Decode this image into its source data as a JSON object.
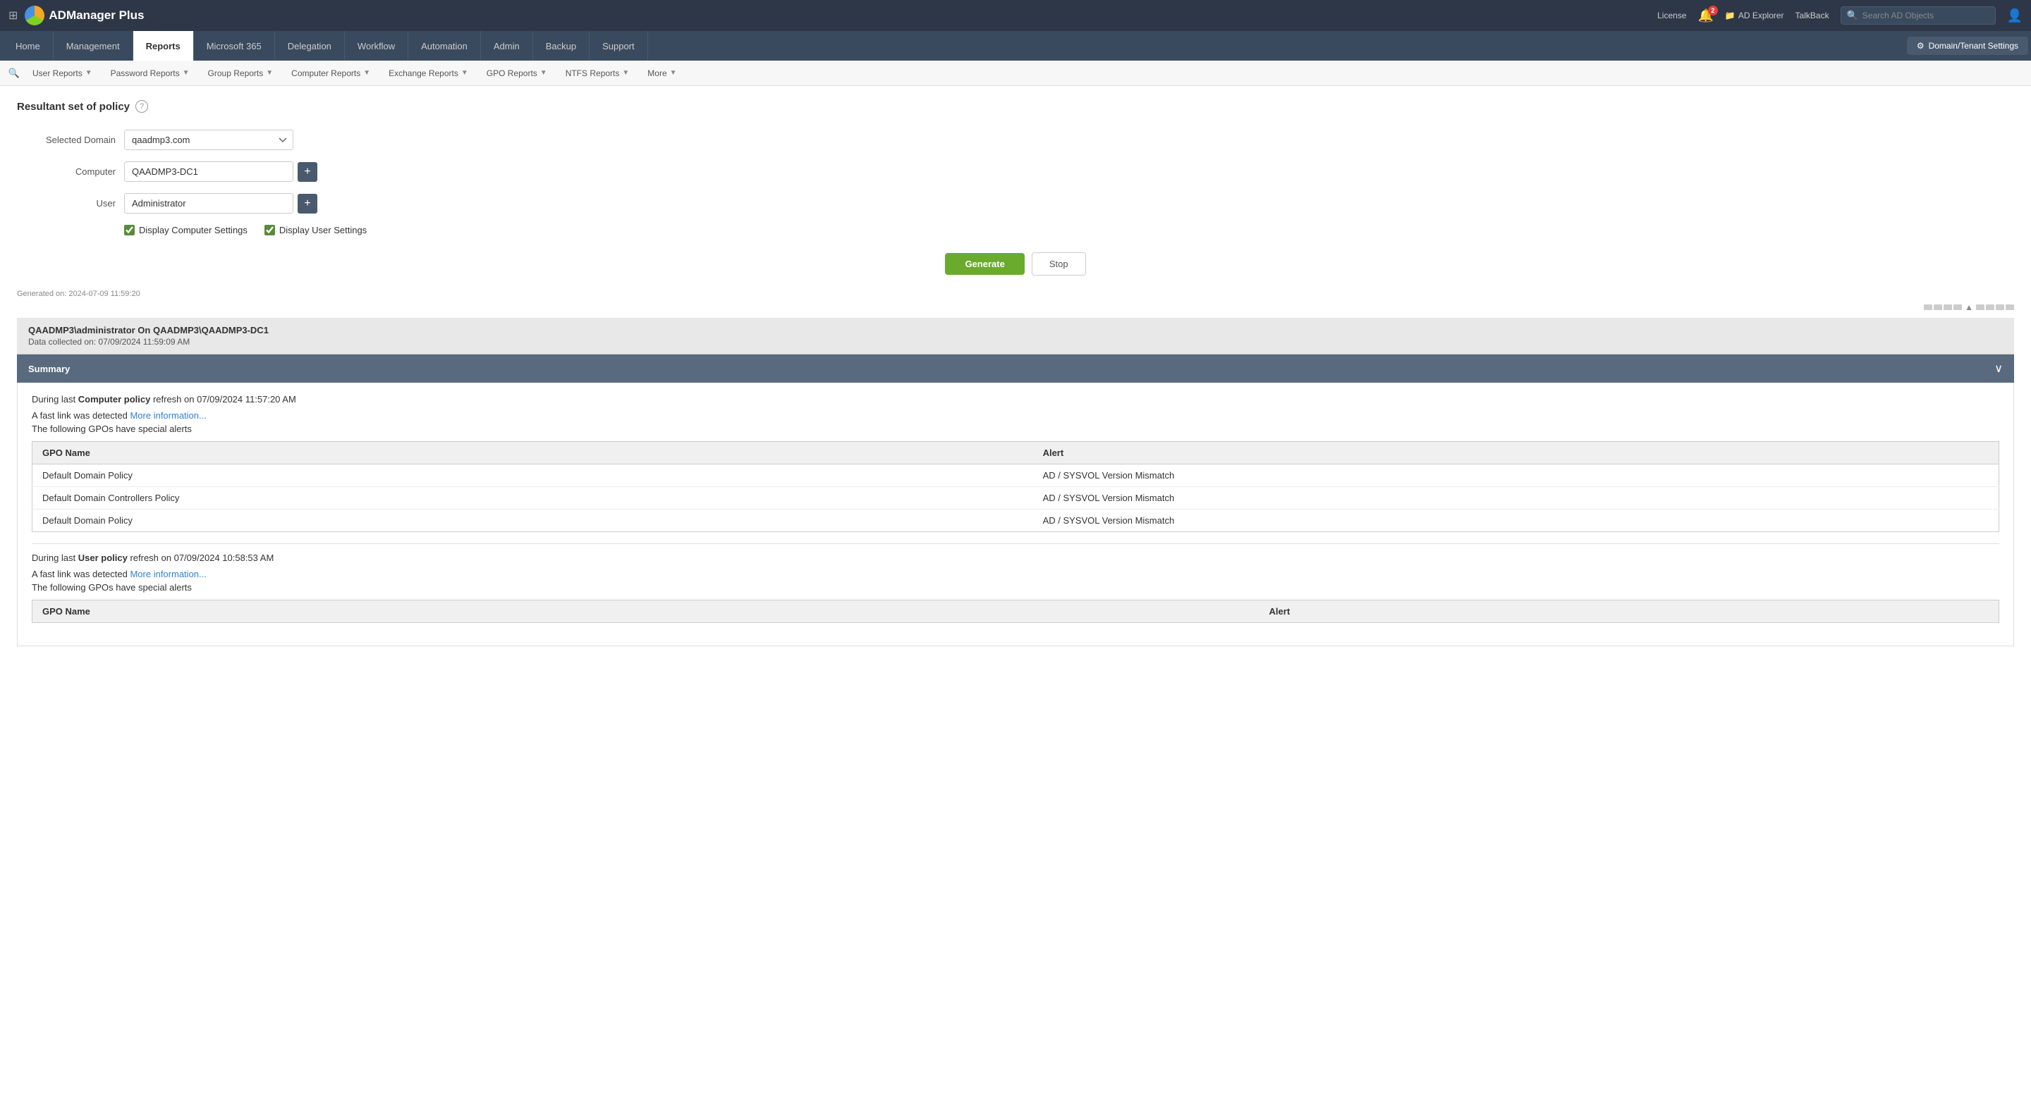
{
  "app": {
    "name": "ADManager Plus",
    "logo_alt": "ADManager Plus Logo"
  },
  "topbar": {
    "license_label": "License",
    "notif_count": "2",
    "ad_explorer_label": "AD Explorer",
    "talkback_label": "TalkBack",
    "search_placeholder": "Search AD Objects"
  },
  "main_nav": {
    "items": [
      {
        "id": "home",
        "label": "Home",
        "active": false
      },
      {
        "id": "management",
        "label": "Management",
        "active": false
      },
      {
        "id": "reports",
        "label": "Reports",
        "active": true
      },
      {
        "id": "microsoft365",
        "label": "Microsoft 365",
        "active": false
      },
      {
        "id": "delegation",
        "label": "Delegation",
        "active": false
      },
      {
        "id": "workflow",
        "label": "Workflow",
        "active": false
      },
      {
        "id": "automation",
        "label": "Automation",
        "active": false
      },
      {
        "id": "admin",
        "label": "Admin",
        "active": false
      },
      {
        "id": "backup",
        "label": "Backup",
        "active": false
      },
      {
        "id": "support",
        "label": "Support",
        "active": false
      }
    ],
    "domain_settings_label": "Domain/Tenant Settings"
  },
  "sub_nav": {
    "search_icon": "🔍",
    "items": [
      {
        "id": "user-reports",
        "label": "User Reports"
      },
      {
        "id": "password-reports",
        "label": "Password Reports"
      },
      {
        "id": "group-reports",
        "label": "Group Reports"
      },
      {
        "id": "computer-reports",
        "label": "Computer Reports"
      },
      {
        "id": "exchange-reports",
        "label": "Exchange Reports"
      },
      {
        "id": "gpo-reports",
        "label": "GPO Reports"
      },
      {
        "id": "ntfs-reports",
        "label": "NTFS Reports"
      },
      {
        "id": "more",
        "label": "More"
      }
    ]
  },
  "page": {
    "title": "Resultant set of policy",
    "help_icon": "?",
    "form": {
      "selected_domain_label": "Selected Domain",
      "selected_domain_value": "qaadmp3.com",
      "computer_label": "Computer",
      "computer_value": "QAADMP3-DC1",
      "user_label": "User",
      "user_value": "Administrator",
      "display_computer_label": "Display Computer Settings",
      "display_user_label": "Display User Settings",
      "generate_btn": "Generate",
      "stop_btn": "Stop"
    },
    "generated_on": "Generated on: 2024-07-09 11:59:20",
    "results": {
      "main_title": "QAADMP3\\administrator On QAADMP3\\QAADMP3-DC1",
      "collected_on": "Data collected on: 07/09/2024 11:59:09 AM",
      "summary_label": "Summary",
      "computer_policy": {
        "text_prefix": "During last ",
        "policy_bold": "Computer policy",
        "text_suffix": " refresh on 07/09/2024 11:57:20 AM",
        "fast_link_text": "A fast link was detected ",
        "fast_link_anchor": "More information...",
        "gpo_note": "The following GPOs have special alerts",
        "table": {
          "col1": "GPO Name",
          "col2": "Alert",
          "rows": [
            {
              "gpo_name": "Default Domain Policy",
              "alert": "AD / SYSVOL Version Mismatch"
            },
            {
              "gpo_name": "Default Domain Controllers Policy",
              "alert": "AD / SYSVOL Version Mismatch"
            },
            {
              "gpo_name": "Default Domain Policy",
              "alert": "AD / SYSVOL Version Mismatch"
            }
          ]
        }
      },
      "user_policy": {
        "text_prefix": "During last ",
        "policy_bold": "User policy",
        "text_suffix": " refresh on 07/09/2024 10:58:53 AM",
        "fast_link_text": "A fast link was detected ",
        "fast_link_anchor": "More information...",
        "gpo_note": "The following GPOs have special alerts",
        "table": {
          "col1": "GPO Name",
          "col2": "Alert"
        }
      }
    }
  },
  "domain_options": [
    "qaadmp3.com"
  ]
}
